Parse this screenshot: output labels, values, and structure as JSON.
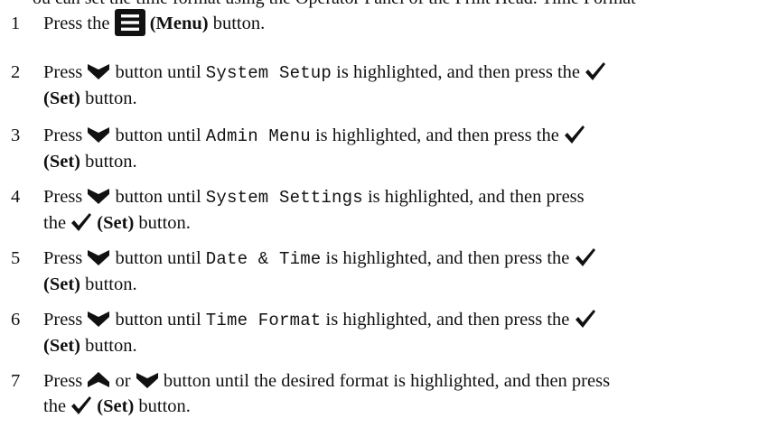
{
  "top_cutoff_text": "ou can set the time format using the Operator Panel of the Print Head. Time Format",
  "steps": [
    {
      "number": "1",
      "pre": "Press the ",
      "button_label": "(Menu)",
      "post": " button."
    },
    {
      "number": "2",
      "press": "Press ",
      "until": " button until ",
      "item": "System Setup",
      "highlighted": " is highlighted, and then press the ",
      "set_label": "(Set)",
      "button": " button."
    },
    {
      "number": "3",
      "press": "Press ",
      "until": " button until ",
      "item": "Admin Menu",
      "highlighted": " is highlighted, and then press the ",
      "set_label": "(Set)",
      "button": " button."
    },
    {
      "number": "4",
      "press": "Press ",
      "until": " button until ",
      "item": "System Settings",
      "highlighted": " is highlighted, and then press",
      "the": "the ",
      "set_label": "(Set)",
      "button": " button."
    },
    {
      "number": "5",
      "press": "Press ",
      "until": " button until ",
      "item": "Date & Time",
      "highlighted": " is highlighted, and then press the ",
      "set_label": "(Set)",
      "button": " button."
    },
    {
      "number": "6",
      "press": "Press ",
      "until": " button until ",
      "item": "Time Format",
      "highlighted": " is highlighted, and then press the ",
      "set_label": "(Set)",
      "button": " button."
    },
    {
      "number": "7",
      "press": "Press ",
      "or": " or ",
      "until_desired": " button until the desired format is highlighted, and then press",
      "the": "the ",
      "set_label": "(Set)",
      "button": " button."
    }
  ],
  "icons": {
    "menu": "menu-icon",
    "down": "down-arrow-icon",
    "up": "up-arrow-icon",
    "set": "checkmark-icon"
  },
  "colors": {
    "text": "#111111",
    "icon": "#111111"
  }
}
